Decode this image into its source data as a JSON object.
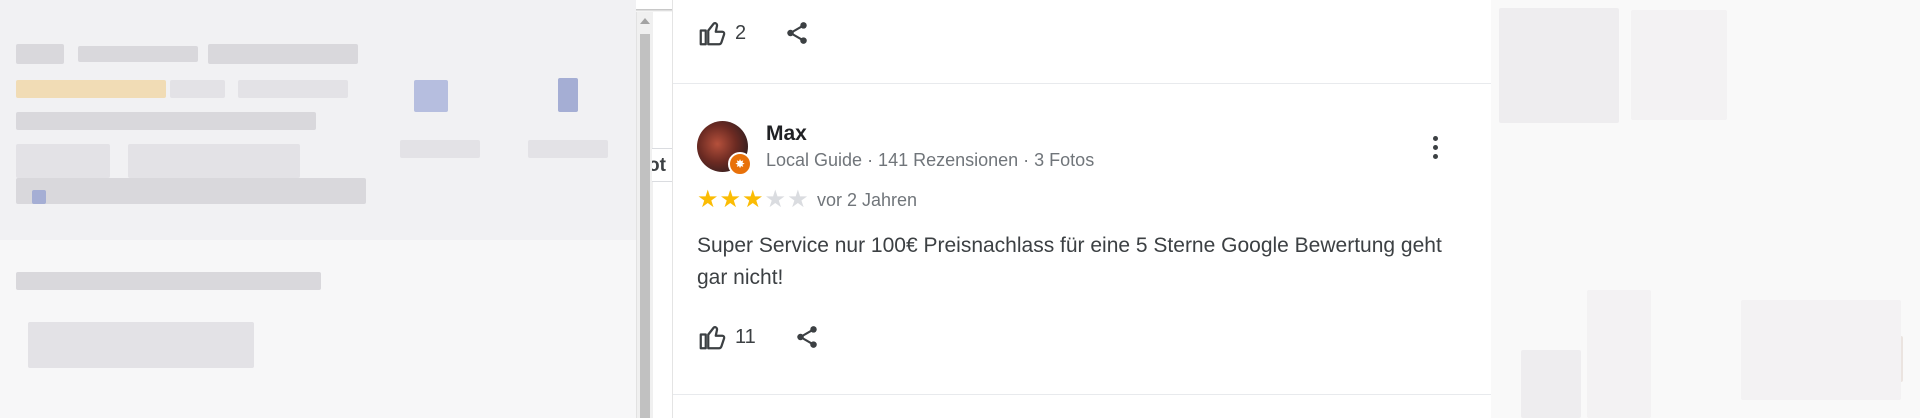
{
  "top_review": {
    "like_count": "2"
  },
  "review": {
    "reviewer_name": "Max",
    "reviewer_meta": "Local Guide · 141 Rezensionen · 3 Fotos",
    "rating": 3,
    "max_rating": 5,
    "star_glyph": "★",
    "date": "vor 2 Jahren",
    "text": "Super Service nur 100€ Preisnachlass für eine 5 Sterne Google Bewertung geht gar nicht!",
    "like_count": "11"
  },
  "side_tab_text": "ot",
  "icons": {
    "like": "thumbs-up-icon",
    "share": "share-icon",
    "more": "more-vert-icon",
    "badge": "local-guide-badge-icon"
  },
  "colors": {
    "star_on": "#fbbc04",
    "star_off": "#dadce0",
    "badge": "#e8710a",
    "text_primary": "#202124",
    "text_secondary": "#70757a"
  }
}
